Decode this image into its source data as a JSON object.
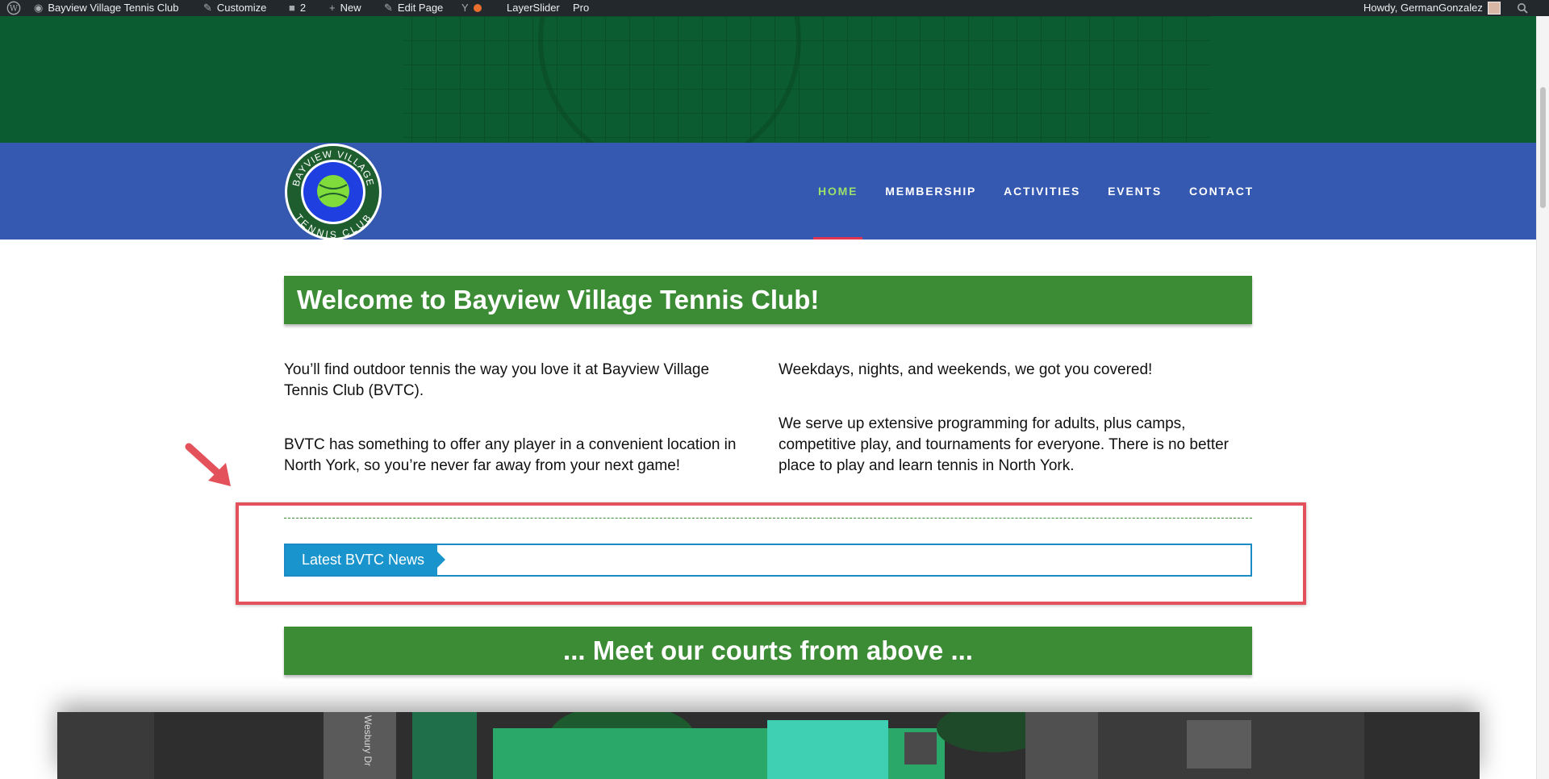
{
  "adminbar": {
    "site_name": "Bayview Village Tennis Club",
    "customize": "Customize",
    "comments_count": "2",
    "new": "New",
    "edit_page": "Edit Page",
    "layerslider": "LayerSlider",
    "pro": "Pro",
    "greeting": "Howdy, GermanGonzalez"
  },
  "logo": {
    "top_text": "BAYVIEW VILLAGE",
    "bottom_text": "TENNIS CLUB"
  },
  "nav": {
    "items": [
      {
        "label": "HOME"
      },
      {
        "label": "MEMBERSHIP"
      },
      {
        "label": "ACTIVITIES"
      },
      {
        "label": "EVENTS"
      },
      {
        "label": "CONTACT"
      }
    ]
  },
  "main": {
    "welcome_title": "Welcome to Bayview Village Tennis Club!",
    "left": {
      "p1": "You’ll find outdoor tennis the way you love it at Bayview Village Tennis Club (BVTC).",
      "p2": "BVTC has something to offer any player in a convenient location in North York, so you’re never far away from your next game!"
    },
    "right": {
      "p1": "Weekdays, nights, and weekends, we got you covered!",
      "p2": "We serve up extensive programming for adults, plus camps, competitive play, and tournaments for everyone. There is no better place to play and learn tennis in North York."
    },
    "news_label": "Latest BVTC News",
    "courts_title": "... Meet our courts from above ...",
    "aerial_street": "Wesbury Dr"
  },
  "colors": {
    "nav_band": "#3558b0",
    "active_nav": "#9be06a",
    "title_bar": "#3c8c35",
    "news_accent": "#1a94cc",
    "highlight": "#e3525a"
  }
}
